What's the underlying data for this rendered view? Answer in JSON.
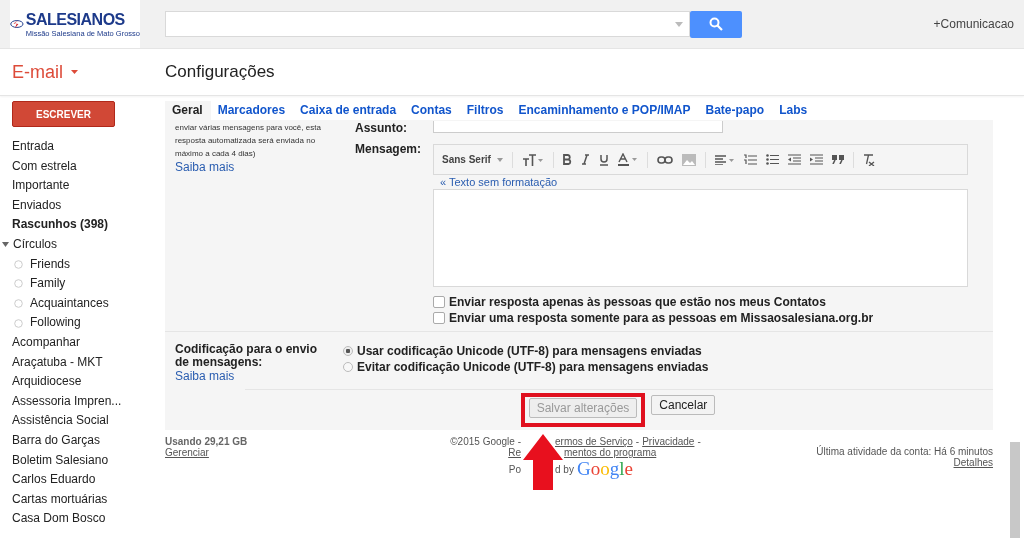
{
  "header": {
    "logo": {
      "name": "SALESIANOS",
      "tagline": "Missão Salesiana de Mato Grosso"
    },
    "account": "+Comunicacao"
  },
  "app_switcher": {
    "label": "E-mail"
  },
  "page_title": "Configurações",
  "compose_button": "ESCREVER",
  "sidebar": {
    "items": [
      {
        "label": "Entrada",
        "bold": false
      },
      {
        "label": "Com estrela",
        "bold": false
      },
      {
        "label": "Importante",
        "bold": false
      },
      {
        "label": "Enviados",
        "bold": false
      },
      {
        "label": "Rascunhos (398)",
        "bold": true
      },
      {
        "label": "Círculos",
        "bold": false,
        "expanded": true,
        "children": [
          {
            "label": "Friends",
            "bold": false
          },
          {
            "label": "Family",
            "bold": false
          },
          {
            "label": "Acquaintances",
            "bold": false
          },
          {
            "label": "Following",
            "bold": false
          }
        ]
      },
      {
        "label": "Acompanhar",
        "bold": false
      },
      {
        "label": "Araçatuba - MKT",
        "bold": false
      },
      {
        "label": "Arquidiocese",
        "bold": false
      },
      {
        "label": "Assessoria Impren...",
        "bold": false
      },
      {
        "label": "Assistência Social",
        "bold": false
      },
      {
        "label": "Barra do Garças",
        "bold": false
      },
      {
        "label": "Boletim Salesiano",
        "bold": false
      },
      {
        "label": "Carlos Eduardo",
        "bold": false
      },
      {
        "label": "Cartas mortuárias",
        "bold": false
      },
      {
        "label": "Casa Dom Bosco",
        "bold": false
      }
    ]
  },
  "tabs": [
    {
      "label": "Geral",
      "selected": true
    },
    {
      "label": "Marcadores",
      "selected": false
    },
    {
      "label": "Caixa de entrada",
      "selected": false
    },
    {
      "label": "Contas",
      "selected": false
    },
    {
      "label": "Filtros",
      "selected": false
    },
    {
      "label": "Encaminhamento e POP/IMAP",
      "selected": false
    },
    {
      "label": "Bate-papo",
      "selected": false
    },
    {
      "label": "Labs",
      "selected": false
    }
  ],
  "vacation": {
    "note": "enviar várias mensagens para você, esta resposta automatizada será enviada no máximo a cada 4 dias)",
    "learn_more": "Saiba mais",
    "subject_label": "Assunto:",
    "message_label": "Mensagem:",
    "font": "Sans Serif",
    "plain_text_link": "« Texto sem formatação",
    "options": [
      {
        "label": "Enviar resposta apenas às pessoas que estão nos meus Contatos",
        "checked": false
      },
      {
        "label": "Enviar uma resposta somente para as pessoas em Missaosalesiana.org.br",
        "checked": false
      }
    ]
  },
  "encoding": {
    "label": "Codificação para o envio de mensagens:",
    "learn_more": "Saiba mais",
    "options": [
      {
        "label": "Usar codificação Unicode (UTF-8) para mensagens enviadas",
        "selected": true
      },
      {
        "label": "Evitar codificação Unicode (UTF-8) para mensagens enviadas",
        "selected": false
      }
    ]
  },
  "buttons": [
    {
      "label": "Salvar alterações",
      "disabled": true,
      "highlighted": true
    },
    {
      "label": "Cancelar",
      "disabled": false,
      "highlighted": false
    }
  ],
  "footer": {
    "storage": "Usando 29,21 GB",
    "manage": "Gerenciar",
    "copyright": "©2015 Google -",
    "terms": "ermos de Serviço",
    "separator_1": "-",
    "privacy": "Privacidade",
    "separator_2": "-",
    "program_start": "Re",
    "program_end": "mentos do programa",
    "powered_start": "Po",
    "powered_end": "d by",
    "brand": "Google",
    "activity": "Última atividade da conta: Há 6 minutos",
    "details": "Detalhes"
  }
}
